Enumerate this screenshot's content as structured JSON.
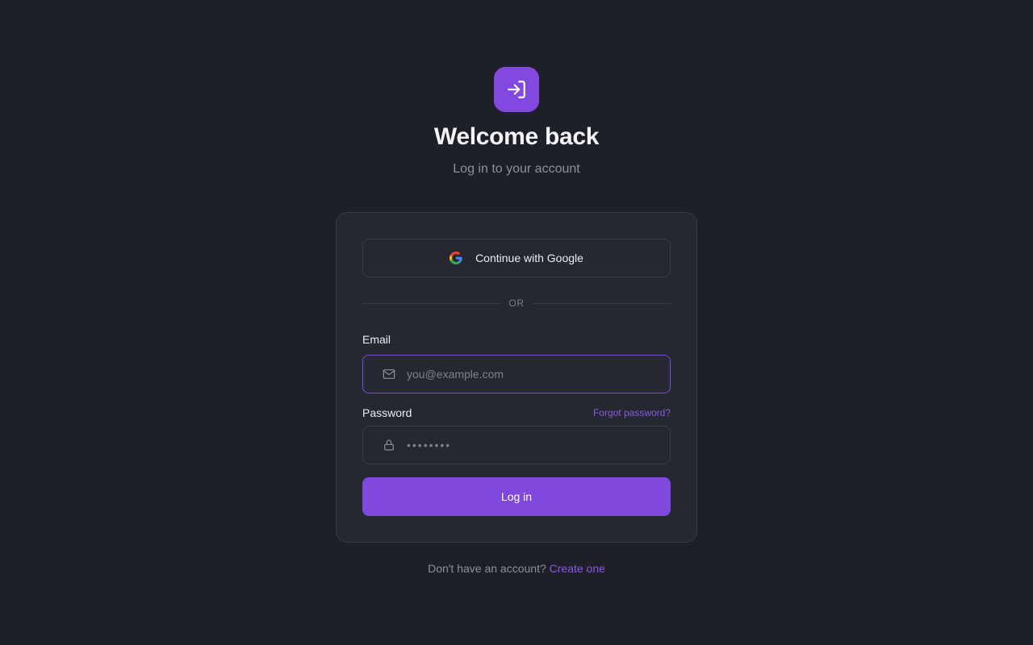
{
  "header": {
    "title": "Welcome back",
    "subtitle": "Log in to your account",
    "logo_icon": "login-arrow-icon"
  },
  "google": {
    "label": "Continue with Google",
    "icon": "google-icon"
  },
  "divider": {
    "text": "OR"
  },
  "email": {
    "label": "Email",
    "placeholder": "you@example.com",
    "value": "",
    "icon": "mail-icon"
  },
  "password": {
    "label": "Password",
    "placeholder": "••••••••",
    "value": "",
    "icon": "lock-icon",
    "forgot_label": "Forgot password?"
  },
  "login_button": {
    "label": "Log in"
  },
  "footer": {
    "prompt": "Don't have an account?",
    "link": "Create one"
  },
  "colors": {
    "background": "#1e2029",
    "card": "#252731",
    "accent": "#8048dc",
    "link": "#8a58e4",
    "muted_text": "#8d8f9c"
  }
}
